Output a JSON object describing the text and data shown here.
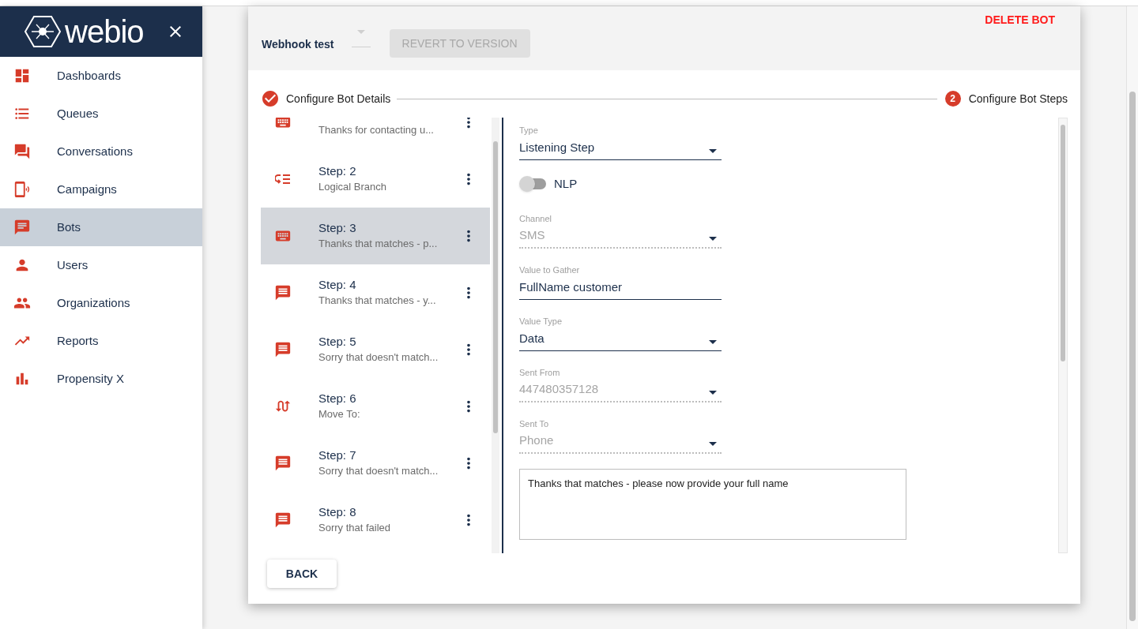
{
  "sidebar": {
    "logo": "webio",
    "items": [
      {
        "label": "Dashboards",
        "selected": false
      },
      {
        "label": "Queues",
        "selected": false
      },
      {
        "label": "Conversations",
        "selected": false
      },
      {
        "label": "Campaigns",
        "selected": false
      },
      {
        "label": "Bots",
        "selected": true
      },
      {
        "label": "Users",
        "selected": false
      },
      {
        "label": "Organizations",
        "selected": false
      },
      {
        "label": "Reports",
        "selected": false
      },
      {
        "label": "Propensity X",
        "selected": false
      }
    ]
  },
  "header": {
    "bot_name": "Webhook test",
    "revert_button": {
      "label": "REVERT TO VERSION",
      "disabled": true
    },
    "delete_button": "DELETE BOT"
  },
  "stepper": [
    {
      "label": "Configure Bot Details",
      "completed": true
    },
    {
      "label": "Configure Bot Steps",
      "number": "2",
      "completed": false
    }
  ],
  "steps": [
    {
      "kind": "keyboard",
      "description": "Thanks for contacting u...",
      "selected": false
    },
    {
      "kind": "branch",
      "title": "Step: 2",
      "description": "Logical Branch",
      "selected": false
    },
    {
      "kind": "keyboard",
      "title": "Step: 3",
      "description": "Thanks that matches - p...",
      "selected": true
    },
    {
      "kind": "message",
      "title": "Step: 4",
      "description": "Thanks that matches - y...",
      "selected": false
    },
    {
      "kind": "message",
      "title": "Step: 5",
      "description": "Sorry that doesn't match...",
      "selected": false
    },
    {
      "kind": "move",
      "title": "Step: 6",
      "description": "Move To:",
      "selected": false
    },
    {
      "kind": "message",
      "title": "Step: 7",
      "description": "Sorry that doesn't match...",
      "selected": false
    },
    {
      "kind": "message",
      "title": "Step: 8",
      "description": "Sorry that failed",
      "selected": false
    }
  ],
  "form": {
    "fields": [
      {
        "kind": "select",
        "label": "Type",
        "value": "Listening Step",
        "disabled": false
      },
      {
        "kind": "toggle",
        "label": "NLP",
        "on": false
      },
      {
        "kind": "select",
        "label": "Channel",
        "value": "SMS",
        "disabled": true
      },
      {
        "kind": "text",
        "label": "Value to Gather",
        "value": "FullName customer",
        "disabled": false
      },
      {
        "kind": "select",
        "label": "Value Type",
        "value": "Data",
        "disabled": false
      },
      {
        "kind": "select",
        "label": "Sent From",
        "value": "447480357128",
        "disabled": true
      },
      {
        "kind": "select",
        "label": "Sent To",
        "value": "Phone",
        "disabled": true
      }
    ],
    "message": "Thanks that matches - please now provide your full name"
  },
  "back_button": "BACK"
}
